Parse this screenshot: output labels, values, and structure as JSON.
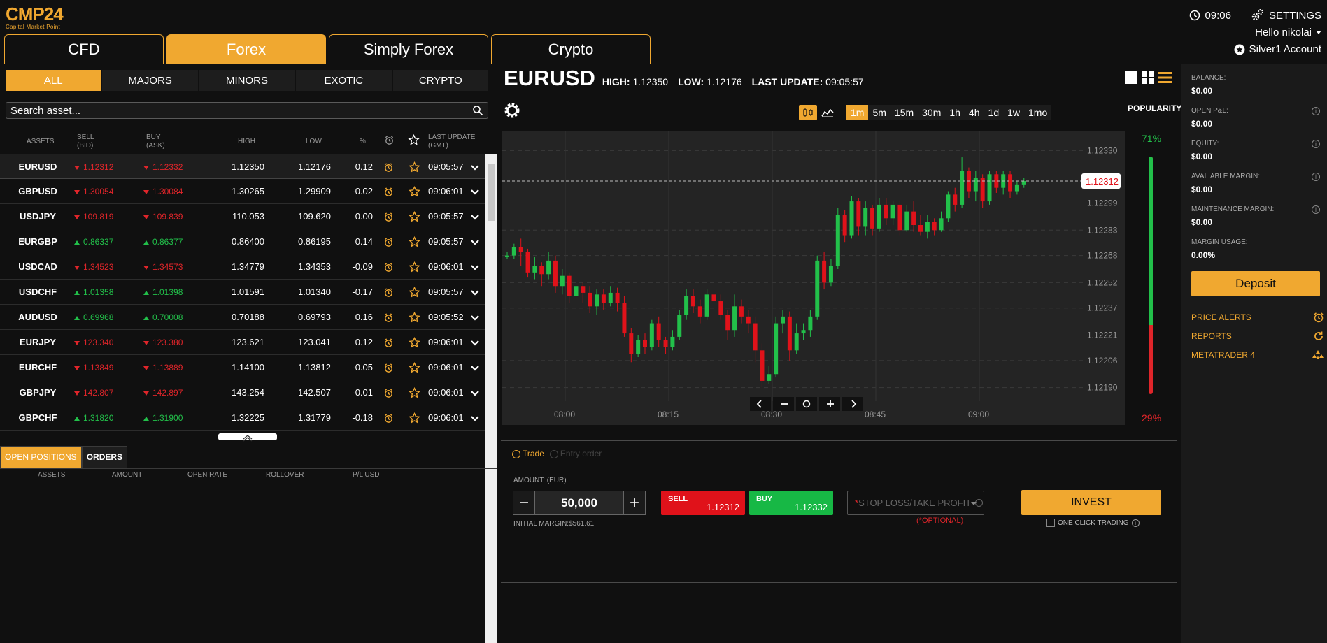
{
  "brand": {
    "logo_text": "CMP24",
    "logo_sub": "Capital Market Point"
  },
  "topbar": {
    "time": "09:06",
    "settings": "SETTINGS",
    "greeting": "Hello nikolai",
    "account": "Silver1 Account"
  },
  "main_tabs": [
    {
      "label": "CFD"
    },
    {
      "label": "Forex"
    },
    {
      "label": "Simply Forex"
    },
    {
      "label": "Crypto"
    }
  ],
  "sub_tabs": [
    {
      "label": "ALL"
    },
    {
      "label": "MAJORS"
    },
    {
      "label": "MINORS"
    },
    {
      "label": "EXOTIC"
    },
    {
      "label": "CRYPTO"
    }
  ],
  "search": {
    "placeholder": "Search asset..."
  },
  "table": {
    "headers": {
      "assets": "ASSETS",
      "sell": "SELL",
      "sell_sub": "(BID)",
      "buy": "BUY",
      "buy_sub": "(ASK)",
      "high": "HIGH",
      "low": "LOW",
      "pct": "%",
      "last_update": "LAST UPDATE",
      "last_update_sub": "(GMT)"
    },
    "rows": [
      {
        "asset": "EURUSD",
        "sell": "1.12312",
        "buy": "1.12332",
        "dir": "dn",
        "high": "1.12350",
        "low": "1.12176",
        "pct": "0.12",
        "updated": "09:05:57"
      },
      {
        "asset": "GBPUSD",
        "sell": "1.30054",
        "buy": "1.30084",
        "dir": "dn",
        "high": "1.30265",
        "low": "1.29909",
        "pct": "-0.02",
        "updated": "09:06:01"
      },
      {
        "asset": "USDJPY",
        "sell": "109.819",
        "buy": "109.839",
        "dir": "dn",
        "high": "110.053",
        "low": "109.620",
        "pct": "0.00",
        "updated": "09:05:57"
      },
      {
        "asset": "EURGBP",
        "sell": "0.86337",
        "buy": "0.86377",
        "dir": "up",
        "high": "0.86400",
        "low": "0.86195",
        "pct": "0.14",
        "updated": "09:05:57"
      },
      {
        "asset": "USDCAD",
        "sell": "1.34523",
        "buy": "1.34573",
        "dir": "dn",
        "high": "1.34779",
        "low": "1.34353",
        "pct": "-0.09",
        "updated": "09:06:01"
      },
      {
        "asset": "USDCHF",
        "sell": "1.01358",
        "buy": "1.01398",
        "dir": "up",
        "high": "1.01591",
        "low": "1.01340",
        "pct": "-0.17",
        "updated": "09:05:57"
      },
      {
        "asset": "AUDUSD",
        "sell": "0.69968",
        "buy": "0.70008",
        "dir": "up",
        "high": "0.70188",
        "low": "0.69793",
        "pct": "0.16",
        "updated": "09:05:52"
      },
      {
        "asset": "EURJPY",
        "sell": "123.340",
        "buy": "123.380",
        "dir": "dn",
        "high": "123.621",
        "low": "123.041",
        "pct": "0.12",
        "updated": "09:06:01"
      },
      {
        "asset": "EURCHF",
        "sell": "1.13849",
        "buy": "1.13889",
        "dir": "dn",
        "high": "1.14100",
        "low": "1.13812",
        "pct": "-0.05",
        "updated": "09:06:01"
      },
      {
        "asset": "GBPJPY",
        "sell": "142.807",
        "buy": "142.897",
        "dir": "dn",
        "high": "143.254",
        "low": "142.507",
        "pct": "-0.01",
        "updated": "09:06:01"
      },
      {
        "asset": "GBPCHF",
        "sell": "1.31820",
        "buy": "1.31900",
        "dir": "up",
        "high": "1.32225",
        "low": "1.31779",
        "pct": "-0.18",
        "updated": "09:06:01"
      }
    ]
  },
  "positions": {
    "tabs": [
      {
        "label": "OPEN POSITIONS"
      },
      {
        "label": "ORDERS"
      }
    ],
    "headers": [
      "ASSETS",
      "AMOUNT",
      "OPEN RATE",
      "ROLLOVER",
      "P/L USD"
    ]
  },
  "instrument": {
    "symbol": "EURUSD",
    "high_label": "HIGH:",
    "high": "1.12350",
    "low_label": "LOW:",
    "low": "1.12176",
    "update_label": "LAST UPDATE:",
    "update": "09:05:57"
  },
  "timeframes": [
    "1m",
    "5m",
    "15m",
    "30m",
    "1h",
    "4h",
    "1d",
    "1w",
    "1mo"
  ],
  "active_timeframe": "1m",
  "chart_data": {
    "type": "candlestick",
    "y_ticks": [
      "1.12330",
      "1.12299",
      "1.12283",
      "1.12268",
      "1.12252",
      "1.12237",
      "1.12221",
      "1.12206",
      "1.12190"
    ],
    "x_ticks": [
      "08:00",
      "08:15",
      "08:30",
      "08:45",
      "09:00"
    ],
    "ylim": [
      1.12182,
      1.12338
    ],
    "current_price": "1.12312",
    "candles": [
      [
        1.12268,
        1.12268,
        1.1227,
        1.12266
      ],
      [
        1.12268,
        1.12273,
        1.12275,
        1.12266
      ],
      [
        1.12273,
        1.1227,
        1.12278,
        1.12262
      ],
      [
        1.1227,
        1.12258,
        1.12272,
        1.12255
      ],
      [
        1.12258,
        1.12262,
        1.12267,
        1.12254
      ],
      [
        1.12262,
        1.12257,
        1.12264,
        1.1225
      ],
      [
        1.12257,
        1.12265,
        1.1227,
        1.12254
      ],
      [
        1.12265,
        1.1225,
        1.12268,
        1.12246
      ],
      [
        1.1225,
        1.12256,
        1.1226,
        1.12245
      ],
      [
        1.12256,
        1.12244,
        1.12258,
        1.1224
      ],
      [
        1.12244,
        1.1225,
        1.12254,
        1.1224
      ],
      [
        1.1225,
        1.12246,
        1.12252,
        1.1224
      ],
      [
        1.12246,
        1.12238,
        1.1225,
        1.12234
      ],
      [
        1.12238,
        1.12245,
        1.12248,
        1.12233
      ],
      [
        1.12245,
        1.1224,
        1.12248,
        1.12236
      ],
      [
        1.1224,
        1.12246,
        1.1225,
        1.12238
      ],
      [
        1.12246,
        1.1224,
        1.12249,
        1.12235
      ],
      [
        1.1224,
        1.12222,
        1.12244,
        1.1222
      ],
      [
        1.12222,
        1.1221,
        1.12225,
        1.12205
      ],
      [
        1.1221,
        1.12218,
        1.12221,
        1.12208
      ],
      [
        1.12218,
        1.12214,
        1.12222,
        1.1221
      ],
      [
        1.12214,
        1.12228,
        1.1223,
        1.12212
      ],
      [
        1.12228,
        1.12218,
        1.12232,
        1.12214
      ],
      [
        1.12218,
        1.12214,
        1.1222,
        1.1221
      ],
      [
        1.12214,
        1.1222,
        1.12224,
        1.12212
      ],
      [
        1.1222,
        1.12233,
        1.12236,
        1.12218
      ],
      [
        1.12233,
        1.12244,
        1.12248,
        1.1223
      ],
      [
        1.12244,
        1.12238,
        1.12248,
        1.12234
      ],
      [
        1.12238,
        1.12232,
        1.12242,
        1.12228
      ],
      [
        1.12232,
        1.12245,
        1.12248,
        1.1223
      ],
      [
        1.12245,
        1.12241,
        1.12248,
        1.12238
      ],
      [
        1.12241,
        1.12233,
        1.12245,
        1.1223
      ],
      [
        1.12233,
        1.12224,
        1.12236,
        1.12218
      ],
      [
        1.12224,
        1.12238,
        1.12245,
        1.1222
      ],
      [
        1.12238,
        1.12232,
        1.12242,
        1.12228
      ],
      [
        1.12232,
        1.12228,
        1.12236,
        1.12222
      ],
      [
        1.12228,
        1.12212,
        1.12232,
        1.12205
      ],
      [
        1.12212,
        1.12194,
        1.12216,
        1.1219
      ],
      [
        1.12194,
        1.12198,
        1.12203,
        1.12192
      ],
      [
        1.12198,
        1.12228,
        1.12232,
        1.12196
      ],
      [
        1.12228,
        1.12232,
        1.12236,
        1.12222
      ],
      [
        1.12232,
        1.12212,
        1.12235,
        1.12206
      ],
      [
        1.12212,
        1.12222,
        1.12228,
        1.1221
      ],
      [
        1.12222,
        1.12224,
        1.12228,
        1.12218
      ],
      [
        1.12224,
        1.12232,
        1.12236,
        1.1222
      ],
      [
        1.12232,
        1.12265,
        1.12268,
        1.1223
      ],
      [
        1.12265,
        1.12252,
        1.1227,
        1.12248
      ],
      [
        1.12252,
        1.12262,
        1.12266,
        1.1225
      ],
      [
        1.12262,
        1.12292,
        1.12296,
        1.1226
      ],
      [
        1.12292,
        1.1228,
        1.12295,
        1.12276
      ],
      [
        1.1228,
        1.123,
        1.12303,
        1.12278
      ],
      [
        1.123,
        1.12285,
        1.12302,
        1.1228
      ],
      [
        1.12285,
        1.12296,
        1.123,
        1.1228
      ],
      [
        1.12296,
        1.12284,
        1.12298,
        1.1228
      ],
      [
        1.12284,
        1.12298,
        1.12302,
        1.12282
      ],
      [
        1.12298,
        1.1229,
        1.12302,
        1.12286
      ],
      [
        1.1229,
        1.12298,
        1.123,
        1.12286
      ],
      [
        1.12298,
        1.12283,
        1.123,
        1.1228
      ],
      [
        1.12283,
        1.12294,
        1.12298,
        1.12282
      ],
      [
        1.12294,
        1.12286,
        1.123,
        1.12282
      ],
      [
        1.12286,
        1.12282,
        1.12292,
        1.1228
      ],
      [
        1.12282,
        1.12288,
        1.12292,
        1.12278
      ],
      [
        1.12288,
        1.12283,
        1.1229,
        1.1228
      ],
      [
        1.12283,
        1.1229,
        1.12294,
        1.12282
      ],
      [
        1.1229,
        1.12304,
        1.12306,
        1.12288
      ],
      [
        1.12304,
        1.12298,
        1.12308,
        1.12294
      ],
      [
        1.12298,
        1.12318,
        1.12326,
        1.12296
      ],
      [
        1.12318,
        1.12306,
        1.1232,
        1.12302
      ],
      [
        1.12306,
        1.12314,
        1.12318,
        1.123
      ],
      [
        1.12314,
        1.123,
        1.12316,
        1.12296
      ],
      [
        1.123,
        1.12316,
        1.12318,
        1.12298
      ],
      [
        1.12316,
        1.12308,
        1.12318,
        1.12305
      ],
      [
        1.12308,
        1.12316,
        1.12318,
        1.12304
      ],
      [
        1.12316,
        1.12306,
        1.12318,
        1.12302
      ],
      [
        1.12306,
        1.1231,
        1.12312,
        1.12304
      ],
      [
        1.1231,
        1.12312,
        1.12314,
        1.12308
      ]
    ]
  },
  "popularity": {
    "label": "POPULARITY",
    "buy_pct": "71%",
    "sell_pct": "29%",
    "buy_fraction": 0.71
  },
  "trade": {
    "mode_trade": "Trade",
    "mode_entry": "Entry order",
    "amount_label": "AMOUNT: (EUR)",
    "amount": "50,000",
    "initial_margin": "INITIAL MARGIN:$561.61",
    "sell_label": "SELL",
    "sell_price": "1.12312",
    "buy_label": "BUY",
    "buy_price": "1.12332",
    "sl_tp": "STOP LOSS/TAKE PROFIT",
    "optional": "(*OPTIONAL)",
    "invest": "INVEST",
    "one_click": "ONE CLICK TRADING"
  },
  "account": {
    "items": [
      {
        "label": "BALANCE:",
        "value": "$0.00"
      },
      {
        "label": "OPEN P&L:",
        "value": "$0.00"
      },
      {
        "label": "EQUITY:",
        "value": "$0.00"
      },
      {
        "label": "AVAILABLE MARGIN:",
        "value": "$0.00"
      },
      {
        "label": "MAINTENANCE MARGIN:",
        "value": "$0.00"
      },
      {
        "label": "MARGIN USAGE:",
        "value": "0.00%"
      }
    ],
    "deposit": "Deposit",
    "links": [
      {
        "label": "PRICE ALERTS",
        "icon": "alarm-icon"
      },
      {
        "label": "REPORTS",
        "icon": "refresh-icon"
      },
      {
        "label": "METATRADER 4",
        "icon": "metatrader-icon"
      }
    ]
  },
  "colors": {
    "accent": "#f0a830",
    "up": "#22c04a",
    "down": "#e0252a"
  }
}
